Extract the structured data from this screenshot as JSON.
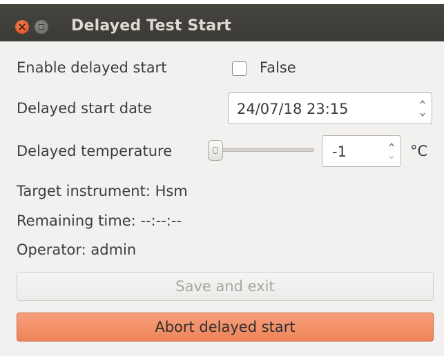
{
  "window": {
    "title": "Delayed Test Start"
  },
  "form": {
    "enable_label": "Enable delayed start",
    "enable_checkbox_label": "False",
    "date_label": "Delayed start date",
    "date_value": "24/07/18 23:15",
    "temperature_label": "Delayed temperature",
    "temperature_value": "-1",
    "temperature_unit": "°C",
    "temperature_slider_level": 0
  },
  "info": {
    "target_instrument": "Target instrument: Hsm",
    "remaining_time": "Remaining time: --:--:--",
    "operator": "Operator: admin"
  },
  "buttons": {
    "save_label": "Save and exit",
    "abort_label": "Abort delayed start"
  },
  "icons": {
    "close": "close-icon",
    "minimize": "minimize-icon",
    "spin_up": "chevron-up-icon",
    "spin_down": "chevron-down-icon",
    "slider_handle": "slider-handle-icon"
  },
  "colors": {
    "titlebar": "#3c3b37",
    "window_bg": "#f2f1f0",
    "close_button": "#e8592c",
    "abort_button": "#f08c63"
  }
}
